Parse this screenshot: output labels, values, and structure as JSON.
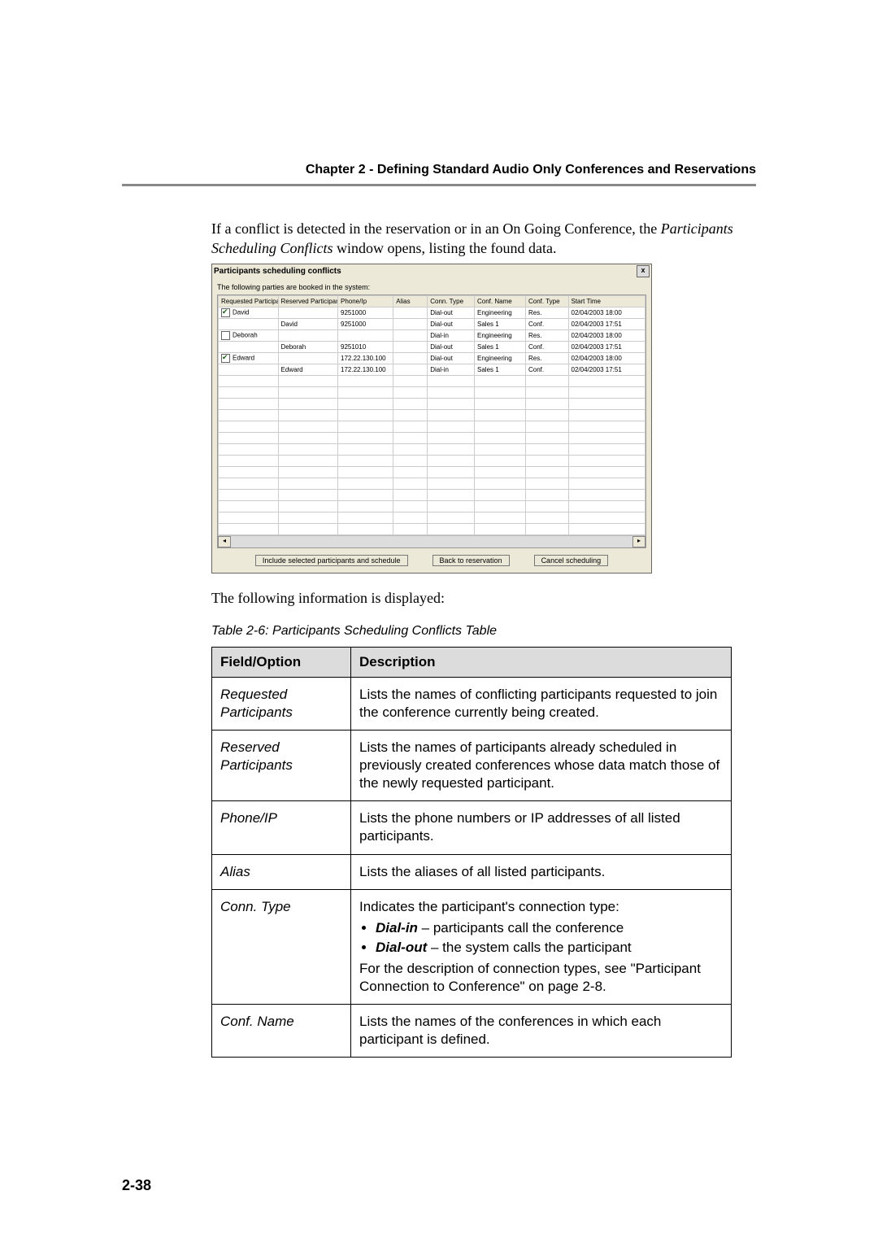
{
  "chapter": "Chapter 2 - Defining Standard Audio Only Conferences and Reservations",
  "intro_1": "If a conflict is detected in the reservation or in an On Going Conference, the ",
  "intro_italic": "Participants Scheduling Conflicts",
  "intro_2": " window opens, listing the found data.",
  "after_text": "The following information is displayed:",
  "table_caption": "Table 2-6: Participants Scheduling Conflicts Table",
  "page_num": "2-38",
  "dialog": {
    "title": "Participants scheduling conflicts",
    "note": "The following parties are booked in the system:",
    "close": "x",
    "headers": [
      "Requested Participants",
      "Reserved Participants",
      "Phone/Ip",
      "Alias",
      "Conn. Type",
      "Conf. Name",
      "Conf. Type",
      "Start Time"
    ],
    "rows": [
      {
        "ck": true,
        "rq": "David",
        "rv": "",
        "ph": "9251000",
        "al": "",
        "ct": "Dial-out",
        "cn": "Engineering",
        "cy": "Res.",
        "st": "02/04/2003 18:00"
      },
      {
        "ck": null,
        "rq": "",
        "rv": "David",
        "ph": "9251000",
        "al": "",
        "ct": "Dial-out",
        "cn": "Sales 1",
        "cy": "Conf.",
        "st": "02/04/2003 17:51"
      },
      {
        "ck": false,
        "rq": "Deborah",
        "rv": "",
        "ph": "",
        "al": "",
        "ct": "Dial-in",
        "cn": "Engineering",
        "cy": "Res.",
        "st": "02/04/2003 18:00"
      },
      {
        "ck": null,
        "rq": "",
        "rv": "Deborah",
        "ph": "9251010",
        "al": "",
        "ct": "Dial-out",
        "cn": "Sales 1",
        "cy": "Conf.",
        "st": "02/04/2003 17:51"
      },
      {
        "ck": true,
        "rq": "Edward",
        "rv": "",
        "ph": "172.22.130.100",
        "al": "",
        "ct": "Dial-out",
        "cn": "Engineering",
        "cy": "Res.",
        "st": "02/04/2003 18:00"
      },
      {
        "ck": null,
        "rq": "",
        "rv": "Edward",
        "ph": "172.22.130.100",
        "al": "",
        "ct": "Dial-in",
        "cn": "Sales 1",
        "cy": "Conf.",
        "st": "02/04/2003 17:51"
      }
    ],
    "buttons": {
      "include": "Include selected participants and schedule",
      "back": "Back to reservation",
      "cancel": "Cancel scheduling"
    }
  },
  "ref_head": {
    "field": "Field/Option",
    "desc": "Description"
  },
  "ref": [
    {
      "f": "Requested Participants",
      "d": "Lists the names of conflicting participants requested to join the conference currently being created."
    },
    {
      "f": "Reserved Participants",
      "d": "Lists the names of participants already scheduled in previously created conferences whose data match those of the newly requested participant."
    },
    {
      "f": "Phone/IP",
      "d": "Lists the phone numbers or IP addresses of all listed participants."
    },
    {
      "f": "Alias",
      "d": "Lists the aliases of all listed participants."
    },
    {
      "f": "Conn. Type",
      "d_intro": "Indicates the participant's connection type:",
      "bul1_b": "Dial-in",
      "bul1_t": " – participants call the conference",
      "bul2_b": "Dial-out",
      "bul2_t": " – the system calls the participant",
      "d_out": "For the description of connection types, see \"Participant Connection to Conference\" on page 2-8."
    },
    {
      "f": "Conf. Name",
      "d": "Lists the names of the conferences in which each participant is defined."
    }
  ]
}
